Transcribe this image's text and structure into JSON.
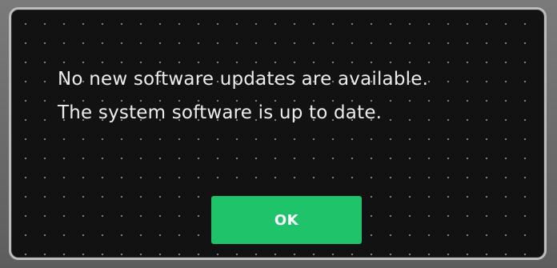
{
  "dialog": {
    "message_line_1": "No new software updates are available.",
    "message_line_2": "The system software is up to date.",
    "ok_label": "OK"
  },
  "colors": {
    "dialog_background": "#121212",
    "dialog_border": "#bdbdbd",
    "text": "#ececec",
    "ok_button": "#1fc46a"
  }
}
